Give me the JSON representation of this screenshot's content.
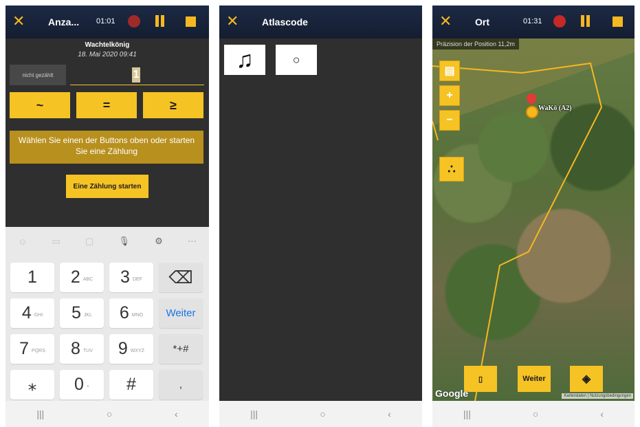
{
  "screen1": {
    "title": "Anza...",
    "time": "01:01",
    "species": "Wachtelkönig",
    "datetime": "18. Mai 2020 09:41",
    "not_counted_label": "nicht gezählt",
    "count_value": "1",
    "operators": [
      "~",
      "=",
      "≥"
    ],
    "hint": "Wählen Sie einen der Buttons oben oder starten Sie eine Zählung",
    "start_label": "Eine Zählung starten",
    "keyboard": {
      "keys": [
        {
          "d": "1",
          "l": ""
        },
        {
          "d": "2",
          "l": "ABC"
        },
        {
          "d": "3",
          "l": "DEF"
        },
        {
          "d": "⌫",
          "l": ""
        },
        {
          "d": "4",
          "l": "GHI"
        },
        {
          "d": "5",
          "l": "JKL"
        },
        {
          "d": "6",
          "l": "MNO"
        },
        {
          "d": "Weiter",
          "l": ""
        },
        {
          "d": "7",
          "l": "PQRS"
        },
        {
          "d": "8",
          "l": "TUV"
        },
        {
          "d": "9",
          "l": "WXYZ"
        },
        {
          "d": "*+#",
          "l": ""
        },
        {
          "d": "⁎",
          "l": ""
        },
        {
          "d": "0",
          "l": "+"
        },
        {
          "d": "#",
          "l": ""
        },
        {
          "d": ",",
          "l": ""
        }
      ],
      "weiter_color": "#1a73e8"
    }
  },
  "screen2": {
    "title": "Atlascode",
    "tiles": [
      "♫",
      "○"
    ]
  },
  "screen3": {
    "title": "Ort",
    "time": "01:31",
    "precision": "Präzision der Position 11,2m",
    "marker_label": "WaKö (A2)",
    "weiter_label": "Weiter",
    "google_label": "Google",
    "attribution": "Kartendaten | Nutzungsbedingungen"
  },
  "nav": [
    "|||",
    "○",
    "‹"
  ],
  "colors": {
    "accent": "#f6c325",
    "header": "#1d2a44",
    "record": "#c62828"
  }
}
